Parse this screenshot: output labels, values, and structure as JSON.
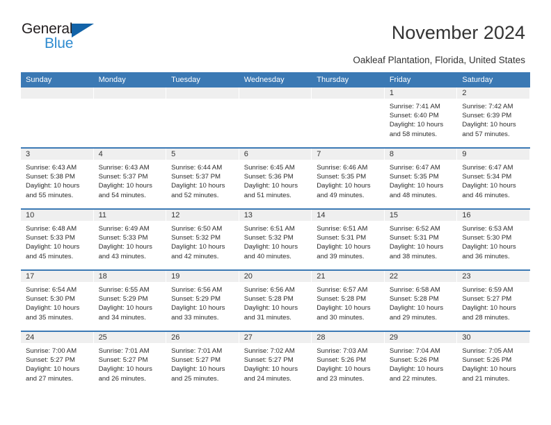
{
  "brand": {
    "name_part1": "General",
    "name_part2": "Blue",
    "triangle_icon": "triangle-icon",
    "accent_blue": "#2e8bd0",
    "dark_blue": "#1263a8"
  },
  "header": {
    "title": "November 2024",
    "subtitle": "Oakleaf Plantation, Florida, United States",
    "header_bg": "#3b79b4",
    "date_band_bg": "#efefef"
  },
  "calendar": {
    "day_headers": [
      "Sunday",
      "Monday",
      "Tuesday",
      "Wednesday",
      "Thursday",
      "Friday",
      "Saturday"
    ],
    "labels": {
      "sunrise": "Sunrise:",
      "sunset": "Sunset:",
      "daylight": "Daylight:"
    },
    "weeks": [
      [
        {
          "day": "",
          "empty": true
        },
        {
          "day": "",
          "empty": true
        },
        {
          "day": "",
          "empty": true
        },
        {
          "day": "",
          "empty": true
        },
        {
          "day": "",
          "empty": true
        },
        {
          "day": "1",
          "sunrise": "Sunrise: 7:41 AM",
          "sunset": "Sunset: 6:40 PM",
          "daylight": "Daylight: 10 hours and 58 minutes."
        },
        {
          "day": "2",
          "sunrise": "Sunrise: 7:42 AM",
          "sunset": "Sunset: 6:39 PM",
          "daylight": "Daylight: 10 hours and 57 minutes."
        }
      ],
      [
        {
          "day": "3",
          "sunrise": "Sunrise: 6:43 AM",
          "sunset": "Sunset: 5:38 PM",
          "daylight": "Daylight: 10 hours and 55 minutes."
        },
        {
          "day": "4",
          "sunrise": "Sunrise: 6:43 AM",
          "sunset": "Sunset: 5:37 PM",
          "daylight": "Daylight: 10 hours and 54 minutes."
        },
        {
          "day": "5",
          "sunrise": "Sunrise: 6:44 AM",
          "sunset": "Sunset: 5:37 PM",
          "daylight": "Daylight: 10 hours and 52 minutes."
        },
        {
          "day": "6",
          "sunrise": "Sunrise: 6:45 AM",
          "sunset": "Sunset: 5:36 PM",
          "daylight": "Daylight: 10 hours and 51 minutes."
        },
        {
          "day": "7",
          "sunrise": "Sunrise: 6:46 AM",
          "sunset": "Sunset: 5:35 PM",
          "daylight": "Daylight: 10 hours and 49 minutes."
        },
        {
          "day": "8",
          "sunrise": "Sunrise: 6:47 AM",
          "sunset": "Sunset: 5:35 PM",
          "daylight": "Daylight: 10 hours and 48 minutes."
        },
        {
          "day": "9",
          "sunrise": "Sunrise: 6:47 AM",
          "sunset": "Sunset: 5:34 PM",
          "daylight": "Daylight: 10 hours and 46 minutes."
        }
      ],
      [
        {
          "day": "10",
          "sunrise": "Sunrise: 6:48 AM",
          "sunset": "Sunset: 5:33 PM",
          "daylight": "Daylight: 10 hours and 45 minutes."
        },
        {
          "day": "11",
          "sunrise": "Sunrise: 6:49 AM",
          "sunset": "Sunset: 5:33 PM",
          "daylight": "Daylight: 10 hours and 43 minutes."
        },
        {
          "day": "12",
          "sunrise": "Sunrise: 6:50 AM",
          "sunset": "Sunset: 5:32 PM",
          "daylight": "Daylight: 10 hours and 42 minutes."
        },
        {
          "day": "13",
          "sunrise": "Sunrise: 6:51 AM",
          "sunset": "Sunset: 5:32 PM",
          "daylight": "Daylight: 10 hours and 40 minutes."
        },
        {
          "day": "14",
          "sunrise": "Sunrise: 6:51 AM",
          "sunset": "Sunset: 5:31 PM",
          "daylight": "Daylight: 10 hours and 39 minutes."
        },
        {
          "day": "15",
          "sunrise": "Sunrise: 6:52 AM",
          "sunset": "Sunset: 5:31 PM",
          "daylight": "Daylight: 10 hours and 38 minutes."
        },
        {
          "day": "16",
          "sunrise": "Sunrise: 6:53 AM",
          "sunset": "Sunset: 5:30 PM",
          "daylight": "Daylight: 10 hours and 36 minutes."
        }
      ],
      [
        {
          "day": "17",
          "sunrise": "Sunrise: 6:54 AM",
          "sunset": "Sunset: 5:30 PM",
          "daylight": "Daylight: 10 hours and 35 minutes."
        },
        {
          "day": "18",
          "sunrise": "Sunrise: 6:55 AM",
          "sunset": "Sunset: 5:29 PM",
          "daylight": "Daylight: 10 hours and 34 minutes."
        },
        {
          "day": "19",
          "sunrise": "Sunrise: 6:56 AM",
          "sunset": "Sunset: 5:29 PM",
          "daylight": "Daylight: 10 hours and 33 minutes."
        },
        {
          "day": "20",
          "sunrise": "Sunrise: 6:56 AM",
          "sunset": "Sunset: 5:28 PM",
          "daylight": "Daylight: 10 hours and 31 minutes."
        },
        {
          "day": "21",
          "sunrise": "Sunrise: 6:57 AM",
          "sunset": "Sunset: 5:28 PM",
          "daylight": "Daylight: 10 hours and 30 minutes."
        },
        {
          "day": "22",
          "sunrise": "Sunrise: 6:58 AM",
          "sunset": "Sunset: 5:28 PM",
          "daylight": "Daylight: 10 hours and 29 minutes."
        },
        {
          "day": "23",
          "sunrise": "Sunrise: 6:59 AM",
          "sunset": "Sunset: 5:27 PM",
          "daylight": "Daylight: 10 hours and 28 minutes."
        }
      ],
      [
        {
          "day": "24",
          "sunrise": "Sunrise: 7:00 AM",
          "sunset": "Sunset: 5:27 PM",
          "daylight": "Daylight: 10 hours and 27 minutes."
        },
        {
          "day": "25",
          "sunrise": "Sunrise: 7:01 AM",
          "sunset": "Sunset: 5:27 PM",
          "daylight": "Daylight: 10 hours and 26 minutes."
        },
        {
          "day": "26",
          "sunrise": "Sunrise: 7:01 AM",
          "sunset": "Sunset: 5:27 PM",
          "daylight": "Daylight: 10 hours and 25 minutes."
        },
        {
          "day": "27",
          "sunrise": "Sunrise: 7:02 AM",
          "sunset": "Sunset: 5:27 PM",
          "daylight": "Daylight: 10 hours and 24 minutes."
        },
        {
          "day": "28",
          "sunrise": "Sunrise: 7:03 AM",
          "sunset": "Sunset: 5:26 PM",
          "daylight": "Daylight: 10 hours and 23 minutes."
        },
        {
          "day": "29",
          "sunrise": "Sunrise: 7:04 AM",
          "sunset": "Sunset: 5:26 PM",
          "daylight": "Daylight: 10 hours and 22 minutes."
        },
        {
          "day": "30",
          "sunrise": "Sunrise: 7:05 AM",
          "sunset": "Sunset: 5:26 PM",
          "daylight": "Daylight: 10 hours and 21 minutes."
        }
      ]
    ]
  }
}
